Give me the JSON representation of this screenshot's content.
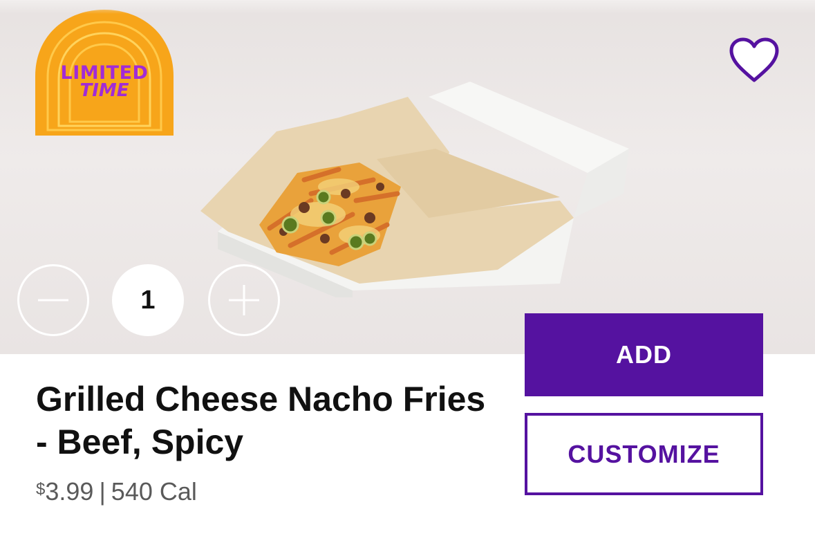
{
  "badge": {
    "line1": "LIMITED",
    "line2": "TIME"
  },
  "favorite": {
    "icon": "heart-outline-icon"
  },
  "quantity": {
    "value": "1",
    "decrement_icon": "minus-icon",
    "increment_icon": "plus-icon"
  },
  "actions": {
    "add_label": "ADD",
    "customize_label": "CUSTOMIZE"
  },
  "product": {
    "name": "Grilled Cheese Nacho Fries - Beef, Spicy",
    "currency": "$",
    "price": "3.99",
    "separator": "|",
    "calories": "540 Cal"
  },
  "colors": {
    "brand_purple": "#5512a0",
    "badge_orange": "#f7a51a",
    "badge_text": "#a12bd6"
  }
}
